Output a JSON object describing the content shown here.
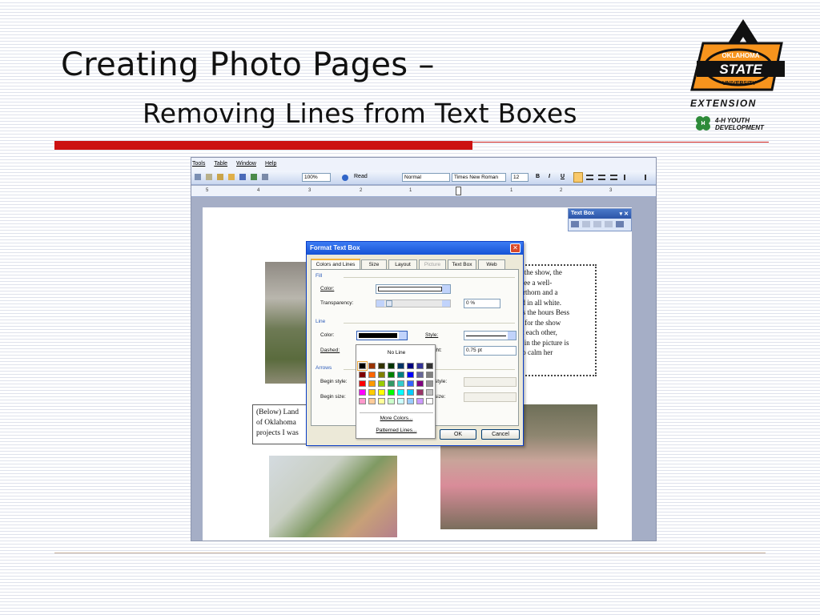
{
  "slide": {
    "title_line1": "Creating Photo Pages –",
    "title_line2": "Removing Lines from Text Boxes"
  },
  "logo": {
    "top_text": "OKLAHOMA",
    "main_text": "STATE",
    "sub_text": "UNIVERSITY",
    "extension": "EXTENSION",
    "youth_line1": "4-H YOUTH",
    "youth_line2": "DEVELOPMENT",
    "colors": {
      "orange": "#f7941d",
      "black": "#111111",
      "green": "#2e8b3a"
    }
  },
  "word": {
    "menu": [
      "Tools",
      "Table",
      "Window",
      "Help"
    ],
    "toolbar": {
      "zoom": "100%",
      "read_label": "Read",
      "style": "Normal",
      "font": "Times New Roman",
      "size": "12",
      "bold": "B",
      "italic": "I",
      "underline": "U"
    },
    "ruler_numbers": [
      "5",
      "4",
      "3",
      "2",
      "1",
      "1",
      "2",
      "3"
    ],
    "textbox_toolbar_title": "Text Box",
    "textbox_toolbar_controls": "▾ ✕",
    "textbox_text": [
      "ch the show, the",
      "d see a well-",
      "horthorn and a",
      "sed in all white.",
      "e is the hours Bess",
      "ng for the show",
      "ust each other,",
      "en in the picture is",
      "s to calm her"
    ],
    "caption_text": [
      "(Below) Land",
      "of Oklahoma",
      "projects I was"
    ]
  },
  "dialog": {
    "title": "Format Text Box",
    "close": "✕",
    "tabs": [
      "Colors and Lines",
      "Size",
      "Layout",
      "Picture",
      "Text Box",
      "Web"
    ],
    "fill_section": "Fill",
    "fill_color_label": "Color:",
    "transparency_label": "Transparency:",
    "transparency_value": "0 %",
    "line_section": "Line",
    "line_color_label": "Color:",
    "style_label": "Style:",
    "dashed_label": "Dashed:",
    "weight_label": "ght:",
    "weight_value": "0.75 pt",
    "arrows_section": "Arrows",
    "begin_style_label": "Begin style:",
    "begin_size_label": "Begin size:",
    "end_style_label": "style:",
    "end_size_label": "size:",
    "ok": "OK",
    "cancel": "Cancel"
  },
  "palette": {
    "no_line": "No Line",
    "more_colors": "More Colors...",
    "patterned_lines": "Patterned Lines...",
    "colors": [
      "#000000",
      "#993300",
      "#333300",
      "#003300",
      "#003366",
      "#000080",
      "#333399",
      "#333333",
      "#800000",
      "#ff6600",
      "#808000",
      "#008000",
      "#008080",
      "#0000ff",
      "#666699",
      "#808080",
      "#ff0000",
      "#ff9900",
      "#99cc00",
      "#339966",
      "#33cccc",
      "#3366ff",
      "#800080",
      "#969696",
      "#ff00ff",
      "#ffcc00",
      "#ffff00",
      "#00ff00",
      "#00ffff",
      "#00ccff",
      "#993366",
      "#c0c0c0",
      "#ff99cc",
      "#ffcc99",
      "#ffff99",
      "#ccffcc",
      "#ccffff",
      "#99ccff",
      "#cc99ff",
      "#ffffff"
    ]
  }
}
